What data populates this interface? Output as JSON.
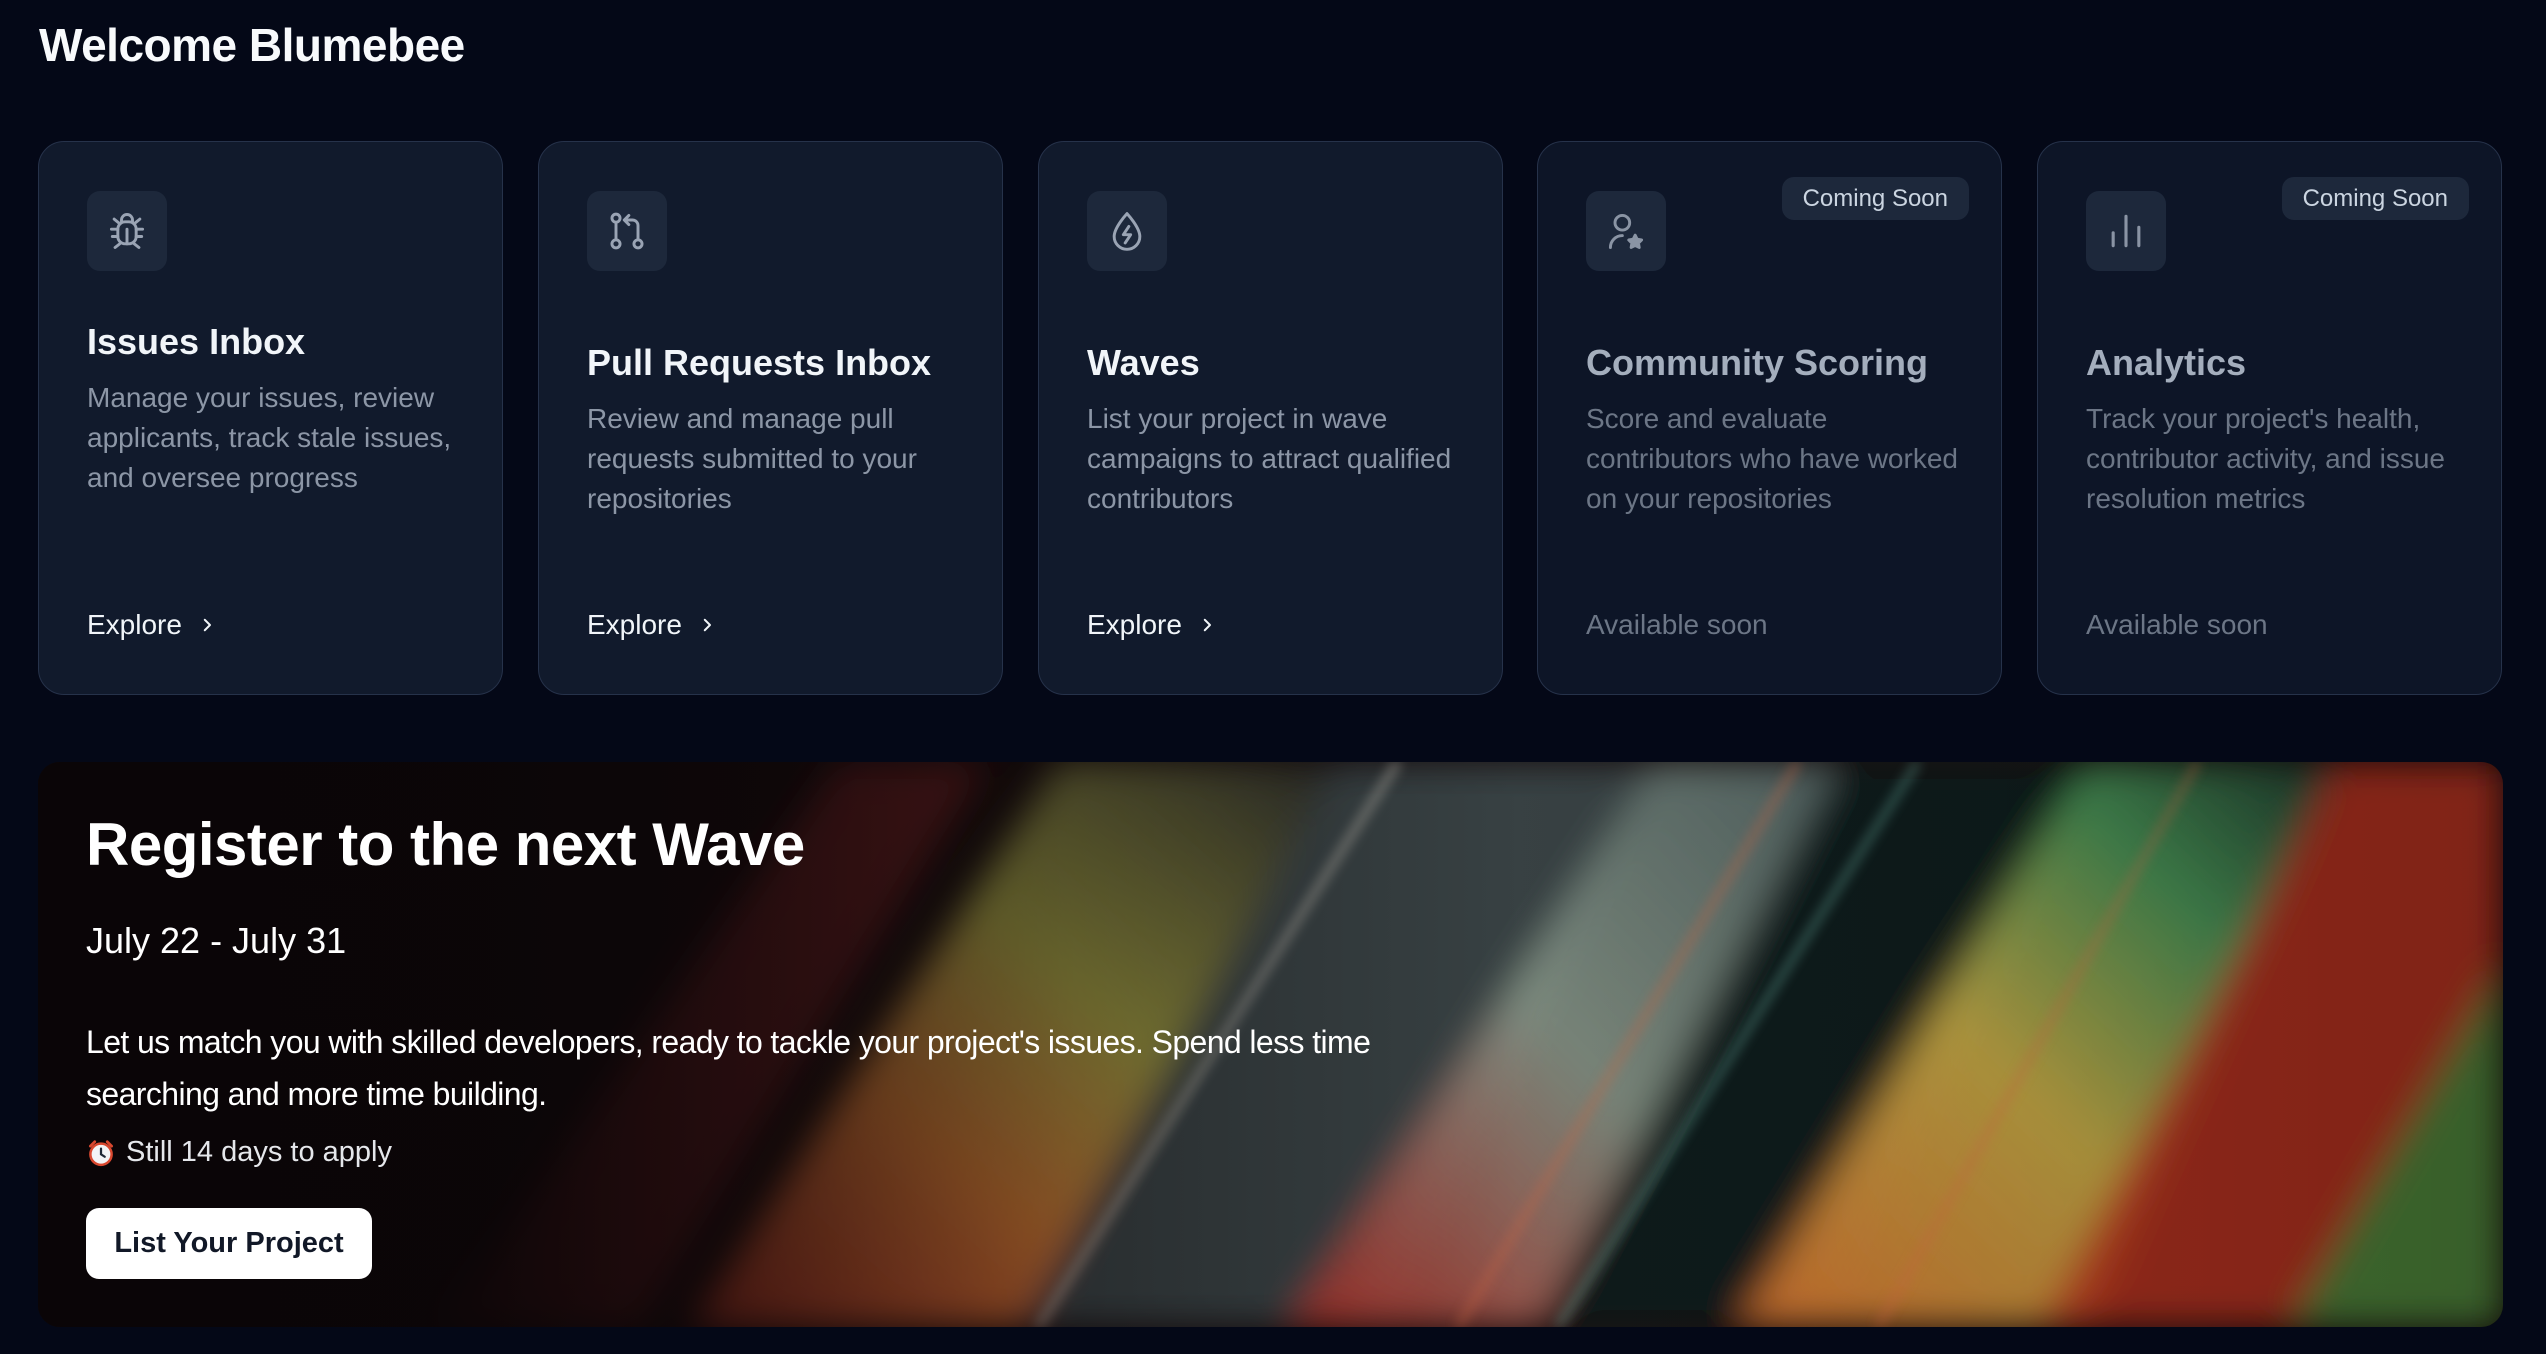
{
  "page": {
    "title": "Welcome Blumebee"
  },
  "cards": [
    {
      "icon": "bug-icon",
      "title": "Issues Inbox",
      "description": "Manage your issues, review applicants, track stale issues, and oversee progress",
      "cta": "Explore",
      "badge": ""
    },
    {
      "icon": "pull-request-icon",
      "title": "Pull Requests Inbox",
      "description": "Review and manage pull requests submitted to your repositories",
      "cta": "Explore",
      "badge": ""
    },
    {
      "icon": "droplet-bolt-icon",
      "title": "Waves",
      "description": "List your project in wave campaigns to attract qualified contributors",
      "cta": "Explore",
      "badge": ""
    },
    {
      "icon": "user-star-icon",
      "title": "Community Scoring",
      "description": "Score and evaluate contributors who have worked on your repositories",
      "cta": "Available soon",
      "badge": "Coming Soon"
    },
    {
      "icon": "bar-chart-icon",
      "title": "Analytics",
      "description": "Track your project's health, contributor activity, and issue resolution metrics",
      "cta": "Available soon",
      "badge": "Coming Soon"
    }
  ],
  "banner": {
    "title": "Register to the next Wave",
    "dates": "July 22 - July 31",
    "description": "Let us match you with skilled developers, ready to tackle your project's issues. Spend less time searching and more time building.",
    "countdown_icon": "alarm-clock-icon",
    "countdown": "Still 14 days to apply",
    "button_label": "List Your Project"
  }
}
